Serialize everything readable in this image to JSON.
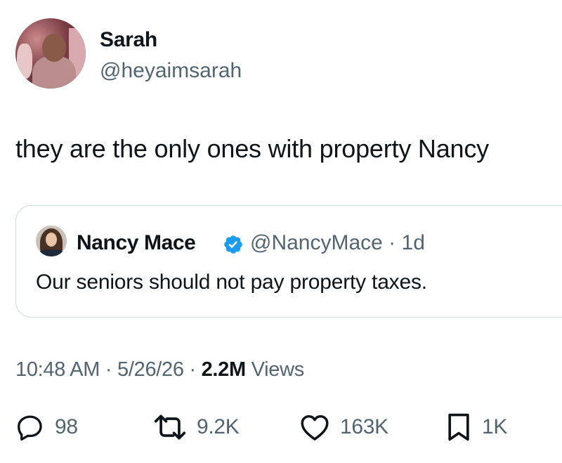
{
  "author": {
    "display_name": "Sarah",
    "handle": "@heyaimsarah",
    "avatar_icon": "profile-photo"
  },
  "tweet": {
    "text": "they are the only ones with property Nancy"
  },
  "quoted_tweet": {
    "display_name": "Nancy Mace",
    "verified_icon": "verified-badge-icon",
    "handle_time": "@NancyMace · 1d",
    "text": "Our seniors should not pay property taxes."
  },
  "meta": {
    "time": "10:48 AM",
    "separator": "·",
    "date": "5/26/26",
    "views_count": "2.2M",
    "views_label": "Views"
  },
  "actions": {
    "replies": "98",
    "reposts": "9.2K",
    "likes": "163K",
    "bookmarks": "1K"
  },
  "colors": {
    "text_primary": "#0f1419",
    "text_secondary": "#536471",
    "border": "#cfd9de",
    "verified": "#1d9bf0"
  }
}
